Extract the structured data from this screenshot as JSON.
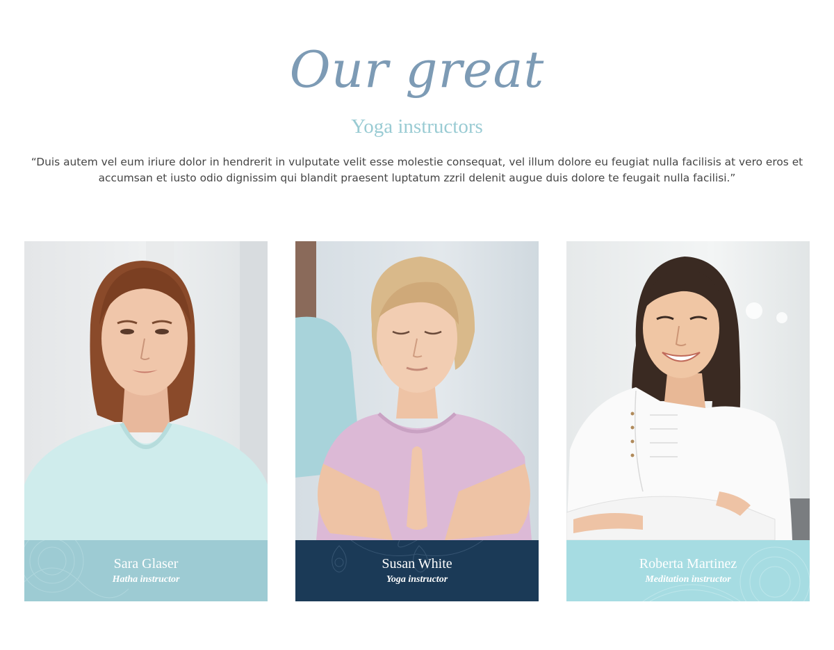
{
  "header": {
    "script_title": "Our great",
    "subtitle": "Yoga instructors",
    "quote": "“Duis autem vel eum iriure dolor in hendrerit in vulputate velit esse molestie consequat, vel illum dolore eu feugiat nulla facilisis at vero eros et accumsan et iusto odio dignissim qui blandit praesent luptatum zzril delenit augue duis dolore te feugait nulla facilisi.”"
  },
  "colors": {
    "script_title": "#7d9bb5",
    "subtitle": "#99cbd3",
    "body_text": "#444444"
  },
  "instructors": [
    {
      "name": "Sara Glaser",
      "role": "Hatha instructor",
      "caption_color": "#9dcbd3",
      "photo": "portrait of woman with auburn hair in light blue t-shirt"
    },
    {
      "name": "Susan White",
      "role": "Yoga instructor",
      "caption_color": "#1b3a57",
      "photo": "blonde woman meditating with hands in prayer pose, pink t-shirt"
    },
    {
      "name": "Roberta Martinez",
      "role": "Meditation instructor",
      "caption_color": "#a6dce2",
      "photo": "smiling woman with long dark hair in white blouse, arms crossed"
    }
  ]
}
